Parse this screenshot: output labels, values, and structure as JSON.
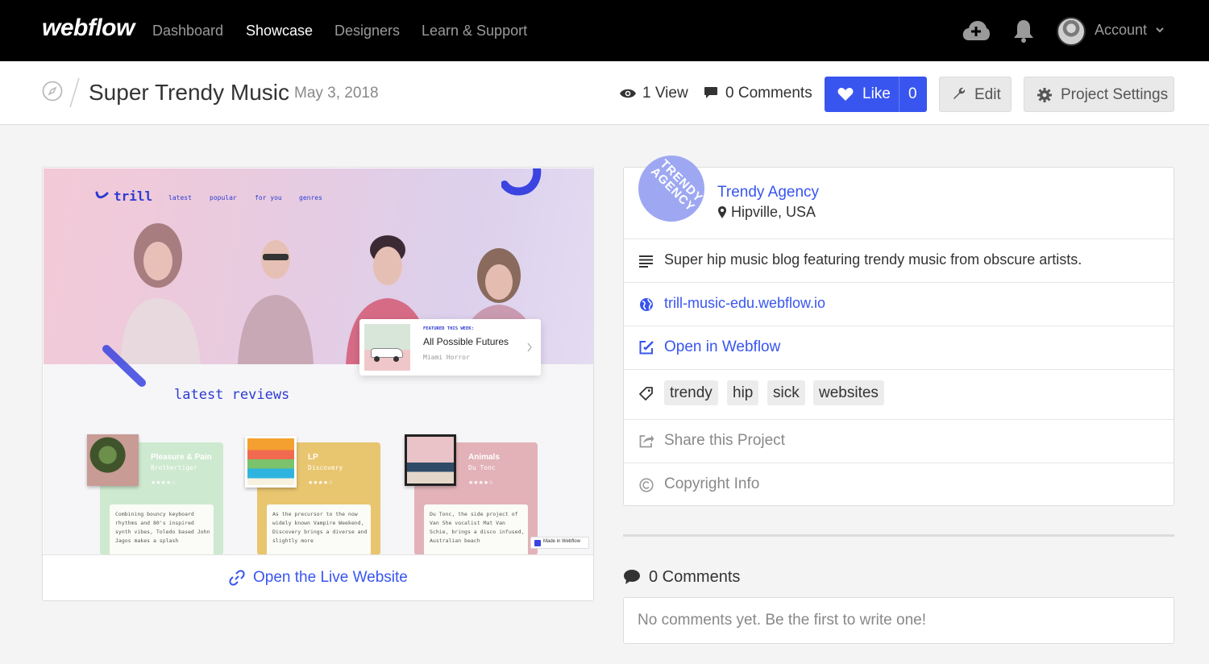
{
  "nav": {
    "logo": "webflow",
    "links": [
      "Dashboard",
      "Showcase",
      "Designers",
      "Learn & Support"
    ],
    "active": "Showcase",
    "account_label": "Account",
    "icons": [
      "cloud-upload-icon",
      "bell-icon",
      "avatar",
      "chevron-down-icon"
    ]
  },
  "project": {
    "title": "Super Trendy Music",
    "date": "May 3, 2018",
    "views": "1 View",
    "comments": "0 Comments",
    "like_label": "Like",
    "like_count": "0",
    "edit_label": "Edit",
    "settings_label": "Project Settings"
  },
  "preview": {
    "site_logo": "trill",
    "site_nav": [
      "latest",
      "popular",
      "for you",
      "genres"
    ],
    "featured_kicker": "FEATURED THIS WEEK:",
    "featured_title": "All Possible Futures",
    "featured_artist": "Miami Horror",
    "section_title": "latest reviews",
    "reviews": [
      {
        "title": "Pleasure & Pain",
        "artist": "Brothertiger",
        "stars": "★★★★☆",
        "desc": "Combining bouncy keyboard rhythms and 80's inspired synth vibes, Toledo based John Jagos makes a splash",
        "color": "#cde9cf"
      },
      {
        "title": "LP",
        "artist": "Discovery",
        "stars": "★★★★☆",
        "desc": "As the precursor to the now widely known Vampire Weekend, Discovery brings a diverse and slightly more",
        "color": "#e8c56f"
      },
      {
        "title": "Animals",
        "artist": "Du Tonc",
        "stars": "★★★★☆",
        "desc": "Du Tonc, the side project of Van She vocalist Mat Van Schie, brings a disco infused, Australian beach",
        "color": "#e2b2b8"
      }
    ],
    "made_in": "Made in Webflow",
    "live_link": "Open the Live Website"
  },
  "info": {
    "author_name": "Trendy Agency",
    "badge_text": "TRENDY AGENCY",
    "location": "Hipville, USA",
    "description": "Super hip music blog featuring trendy music from obscure artists.",
    "url": "trill-music-edu.webflow.io",
    "open_in_webflow": "Open in Webflow",
    "tags": [
      "trendy",
      "hip",
      "sick",
      "websites"
    ],
    "share": "Share this Project",
    "copyright": "Copyright Info"
  },
  "comments": {
    "title": "0 Comments",
    "placeholder": "No comments yet. Be the first to write one!"
  },
  "colors": {
    "accent": "#3855f0",
    "nav_bg": "#000000",
    "page_bg": "#f4f4f4"
  }
}
